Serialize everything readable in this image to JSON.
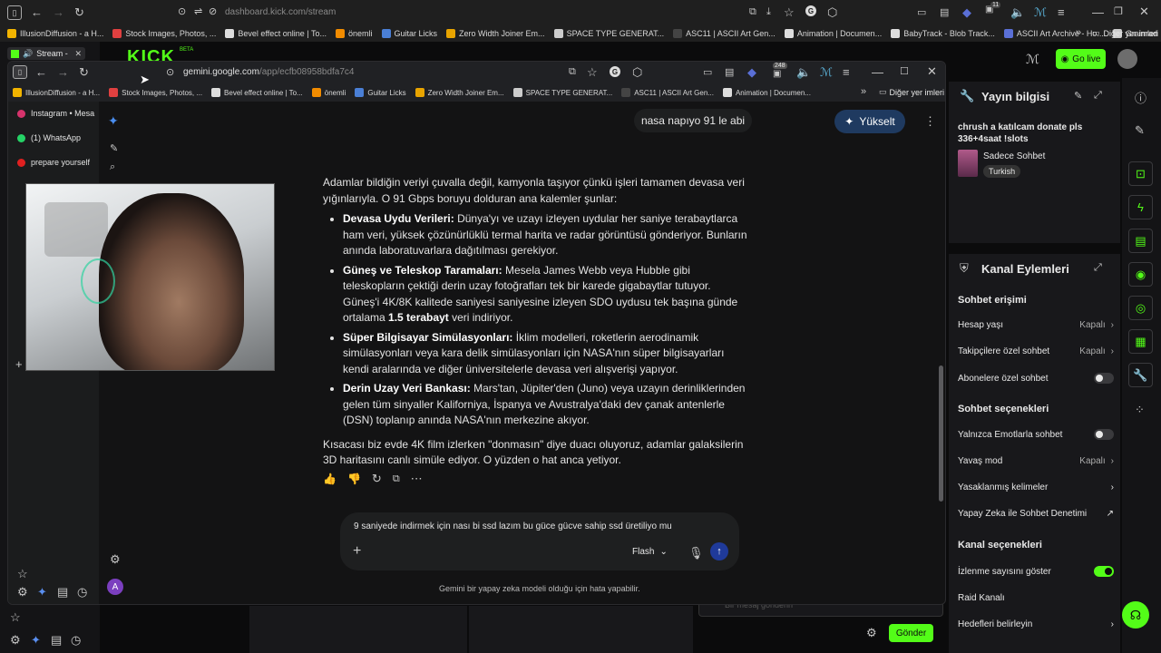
{
  "outer_browser": {
    "url_prefix": "dashboard.",
    "url_domain": "kick.com",
    "url_path": "/stream",
    "tab_title": "Stream - ",
    "bookmarks": [
      {
        "label": "IllusionDiffusion - a H...",
        "color": "#f2b400"
      },
      {
        "label": "Stock Images, Photos, ...",
        "color": "#e04040"
      },
      {
        "label": "Bevel effect online | To...",
        "color": "#dddddd"
      },
      {
        "label": "önemli",
        "color": "#f28c00"
      },
      {
        "label": "Guitar Licks",
        "color": "#4a7fd6"
      },
      {
        "label": "Zero Width Joiner Em...",
        "color": "#e8a400"
      },
      {
        "label": "SPACE TYPE GENERAT...",
        "color": "#cccccc"
      },
      {
        "label": "ASC11 | ASCII Art Gen...",
        "color": "#444444"
      },
      {
        "label": "Animation | Documen...",
        "color": "#dddddd"
      },
      {
        "label": "BabyTrack - Blob Track...",
        "color": "#dddddd"
      },
      {
        "label": "ASCII Art Archive - Ho...",
        "color": "#5a6fd6"
      },
      {
        "label": "Grainrad",
        "color": "#cccccc"
      }
    ],
    "other_bookmarks": "Diğer yer imleri",
    "badge_count": "11"
  },
  "kick": {
    "logo_badge": "BETA",
    "go_live": "Go live",
    "send_button": "Gönder",
    "chat_placeholder": "Bir mesaj gönderin"
  },
  "yayin_bilgisi": {
    "title": "Yayın bilgisi",
    "stream_title": "chrush a katılcam donate pls 336+4saat !slots",
    "category": "Sadece Sohbet",
    "language_tag": "Turkish"
  },
  "kanal_eylemleri": {
    "title": "Kanal Eylemleri",
    "sections": {
      "sohbet_erisimi": "Sohbet erişimi",
      "sohbet_secenekleri": "Sohbet seçenekleri",
      "kanal_secenekleri": "Kanal seçenekleri"
    },
    "rows": {
      "hesap_yasi": "Hesap yaşı",
      "takipcilere": "Takipçilere özel sohbet",
      "abonelere": "Abonelere özel sohbet",
      "emotlarla": "Yalnızca Emotlarla sohbet",
      "yavas_mod": "Yavaş mod",
      "yasaklanmis": "Yasaklanmış kelimeler",
      "yapay_zeka": "Yapay Zeka ile Sohbet Denetimi",
      "izlenme": "İzlenme sayısını göster",
      "raid": "Raid Kanalı",
      "hedefler": "Hedefleri belirleyin"
    },
    "off_label": "Kapalı"
  },
  "inner_browser": {
    "url_domain": "gemini.google.com",
    "url_path": "/app/ecfb08958bdfa7c4",
    "badge_count": "248",
    "bookmarks": [
      {
        "label": "IllusionDiffusion - a H...",
        "color": "#f2b400"
      },
      {
        "label": "Stock Images, Photos, ...",
        "color": "#e04040"
      },
      {
        "label": "Bevel effect online | To...",
        "color": "#dddddd"
      },
      {
        "label": "önemli",
        "color": "#f28c00"
      },
      {
        "label": "Guitar Licks",
        "color": "#4a7fd6"
      },
      {
        "label": "Zero Width Joiner Em...",
        "color": "#e8a400"
      },
      {
        "label": "SPACE TYPE GENERAT...",
        "color": "#cccccc"
      },
      {
        "label": "ASC11 | ASCII Art Gen...",
        "color": "#444444"
      },
      {
        "label": "Animation | Documen...",
        "color": "#dddddd"
      }
    ],
    "other_bookmarks": "Diğer yer imleri",
    "side_tabs": [
      {
        "label": "Instagram • Mesa",
        "color": "#d6336c"
      },
      {
        "label": "(1) WhatsApp",
        "color": "#25d366"
      },
      {
        "label": "prepare yourself",
        "color": "#e02020"
      }
    ]
  },
  "gemini": {
    "upgrade": "Yükselt",
    "avatar_letter": "A",
    "user_message": "nasa napıyo 91 le abi",
    "intro": "Adamlar bildiğin veriyi çuvalla değil, kamyonla taşıyor çünkü işleri tamamen devasa veri yığınlarıyla. O 91 Gbps boruyu dolduran ana kalemler şunlar:",
    "bullets": [
      {
        "title": "Devasa Uydu Verileri:",
        "text": " Dünya'yı ve uzayı izleyen uydular her saniye terabaytlarca ham veri, yüksek çözünürlüklü termal harita ve radar görüntüsü gönderiyor. Bunların anında laboratuvarlara dağıtılması gerekiyor."
      },
      {
        "title": "Güneş ve Teleskop Taramaları:",
        "text": " Mesela James Webb veya Hubble gibi teleskopların çektiği derin uzay fotoğrafları tek bir karede gigabaytlar tutuyor. Güneş'i 4K/8K kalitede saniyesi saniyesine izleyen SDO uydusu tek başına günde ortalama ",
        "bold_tail": "1.5 terabayt",
        "tail": " veri indiriyor."
      },
      {
        "title": "Süper Bilgisayar Simülasyonları:",
        "text": " İklim modelleri, roketlerin aerodinamik simülasyonları veya kara delik simülasyonları için NASA'nın süper bilgisayarları kendi aralarında ve diğer üniversitelerle devasa veri alışverişi yapıyor."
      },
      {
        "title": "Derin Uzay Veri Bankası:",
        "text": " Mars'tan, Jüpiter'den (Juno) veya uzayın derinliklerinden gelen tüm sinyaller Kaliforniya, İspanya ve Avustralya'daki dev çanak antenlerle (DSN) toplanıp anında NASA'nın merkezine akıyor."
      }
    ],
    "outro": "Kısacası biz evde 4K film izlerken \"donmasın\" diye duacı oluyoruz, adamlar galaksilerin 3D haritasını canlı simüle ediyor. O yüzden o hat anca yetiyor.",
    "input_text": "9 saniyede indirmek için nası bi ssd lazım bu güce gücve sahip ssd üretiliyo mu",
    "model": "Flash",
    "disclaimer": "Gemini bir yapay zeka modeli olduğu için hata yapabilir."
  },
  "colors": {
    "kick_green": "#53fc18",
    "gemini_blue_button": "#1f3a60"
  },
  "icons": [
    "back-icon",
    "forward-icon",
    "reload-icon",
    "star-icon",
    "gear-icon",
    "history-icon",
    "mic-icon",
    "send-icon",
    "plus-icon",
    "thumb-up-icon",
    "thumb-down-icon",
    "copy-icon",
    "more-icon",
    "pencil-icon",
    "search-icon",
    "popout-icon",
    "chevron-right-icon"
  ]
}
